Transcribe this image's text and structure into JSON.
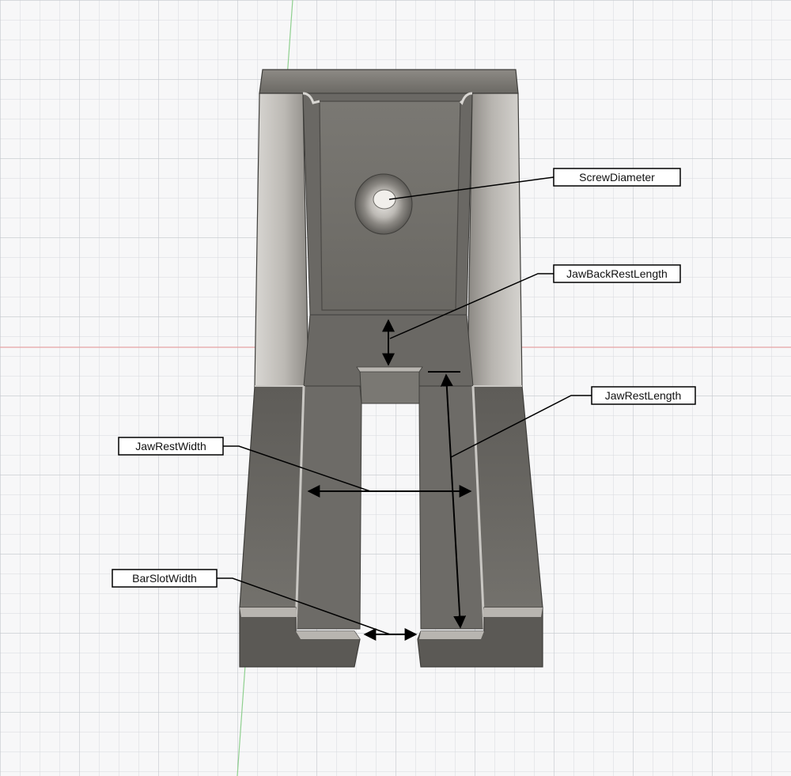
{
  "labels": {
    "screw_diameter": "ScrewDiameter",
    "jaw_back_rest_length": "JawBackRestLength",
    "jaw_rest_length": "JawRestLength",
    "jaw_rest_width": "JawRestWidth",
    "bar_slot_width": "BarSlotWidth"
  },
  "colors": {
    "background": "#f7f7f8",
    "grid_line": "#cfd2d6",
    "x_axis": "#e6a3a3",
    "y_axis": "#8fd08f",
    "part_body": "#6f6d68",
    "part_dark": "#5b5955",
    "part_highlight": "#cfcdc9",
    "annotation": "#000000"
  }
}
